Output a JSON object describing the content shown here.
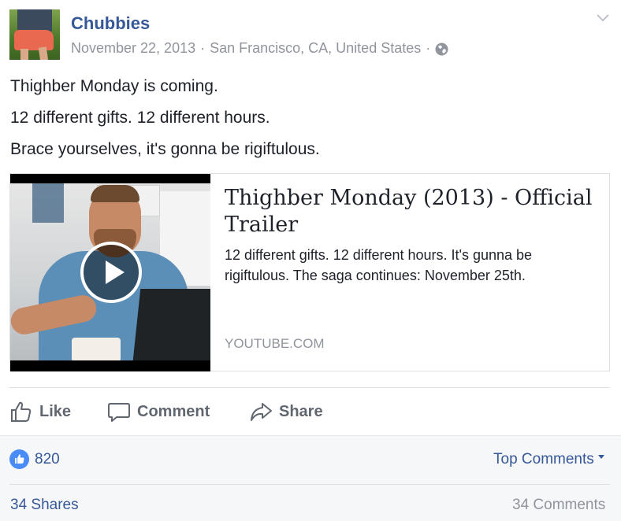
{
  "post": {
    "page_name": "Chubbies",
    "date": "November 22, 2013",
    "separator": "·",
    "location": "San Francisco, CA, United States",
    "privacy_icon": "globe-icon",
    "menu_icon": "chevron-down-icon",
    "text_lines": [
      "Thighber Monday is coming.",
      "12 different gifts. 12 different hours.",
      "Brace yourselves, it's gonna be rigiftulous."
    ]
  },
  "link_card": {
    "title": "Thighber Monday (2013) - Official Trailer",
    "description": "12 different gifts. 12 different hours. It's gunna be rigiftulous. The saga continues: November 25th.",
    "domain": "YOUTUBE.COM",
    "play_icon": "play-icon"
  },
  "actions": {
    "like_label": "Like",
    "comment_label": "Comment",
    "share_label": "Share"
  },
  "footer": {
    "like_count": "820",
    "top_comments_label": "Top Comments",
    "shares_label": "34 Shares",
    "comments_label": "34 Comments"
  },
  "colors": {
    "link_blue": "#365899",
    "meta_gray": "#90949c",
    "action_gray": "#616770",
    "like_badge": "#4a8cf7"
  }
}
